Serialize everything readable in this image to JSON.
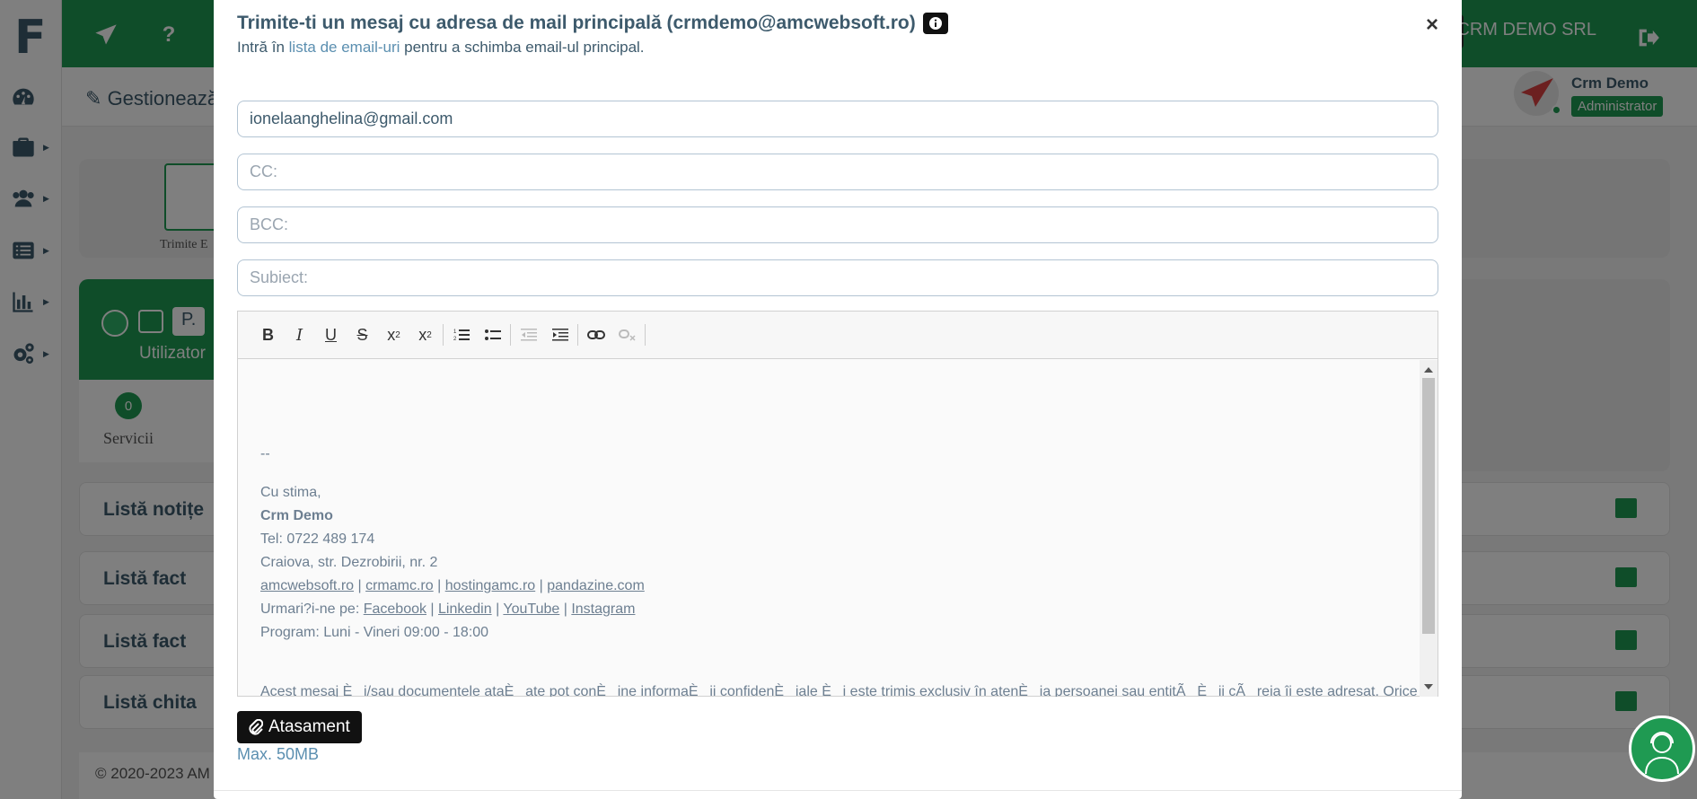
{
  "background": {
    "app_logo": "F",
    "company_name": "CRM DEMO SRL",
    "page_title": "Gestionează",
    "user": {
      "name": "Crm Demo",
      "role": "Administrator"
    },
    "tile_label": "Trimite E",
    "user_card": {
      "name": "P.",
      "label": "Utilizator"
    },
    "services": {
      "count": "0",
      "label": "Servicii"
    },
    "lists": [
      "Listă notițe",
      "Listă fact",
      "Listă fact",
      "Listă chita"
    ],
    "footer": "© 2020-2023 AM"
  },
  "modal": {
    "title": "Trimite-ti un mesaj cu adresa de mail principală (crmdemo@amcwebsoft.ro)",
    "subtitle_before": "Intră în ",
    "subtitle_link": "lista de email-uri",
    "subtitle_after": " pentru a schimba email-ul principal.",
    "close_label": "×",
    "to_value": "ionelaanghelina@gmail.com",
    "cc_placeholder": "CC:",
    "bcc_placeholder": "BCC:",
    "subject_placeholder": "Subiect:",
    "attach_label": "Atasament",
    "max_size": "Max. 50MB"
  },
  "editor": {
    "separator": "--",
    "greeting": "Cu stima,",
    "sender_name": "Crm Demo",
    "phone": "Tel: 0722 489 174",
    "address": "Craiova, str. Dezrobirii, nr. 2",
    "sites": [
      "amcwebsoft.ro",
      "crmamc.ro",
      "hostingamc.ro",
      "pandazine.com"
    ],
    "follow_prefix": "Urmari?i-ne pe:",
    "socials": [
      "Facebook",
      "Linkedin",
      "YouTube",
      "Instagram"
    ],
    "program": "Program: Luni - Vineri 09:00 - 18:00",
    "disclaimer": "Acest mesaj Èi/sau documentele ataÈate pot conÈine informaÈii confidenÈiale Èi este trimis exclusiv în atenÈia persoanei sau entitÃÈii cÃreia îi este adresat. Orice"
  },
  "colors": {
    "green": "#1f9a52",
    "text": "#3d5a6c",
    "link": "#5b8fb0"
  }
}
